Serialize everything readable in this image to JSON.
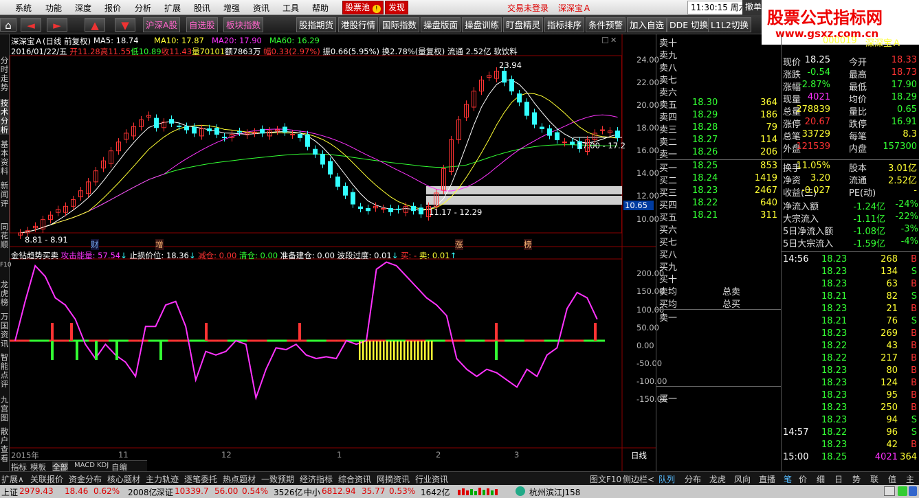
{
  "menu": {
    "items": [
      "系统",
      "功能",
      "深度",
      "报价",
      "分析",
      "扩展",
      "股讯",
      "增强",
      "资讯",
      "工具",
      "帮助"
    ],
    "stock_pool": "股票池",
    "discover": "发现",
    "login_status": "交易未登录",
    "stock_title": "深深宝Ａ",
    "clock": "11:30:15 周六",
    "cancel": "撤单",
    "watermark_title": "股票公式指标网",
    "watermark_url": "www.gsxz.com.cn"
  },
  "toolbar": {
    "home": "⌂",
    "back": "◄",
    "forward": "►",
    "up": "▲",
    "down": "▼",
    "buttons": [
      "沪深A股",
      "自选股",
      "板块指数",
      "股指期货",
      "港股行情",
      "国际指数",
      "操盘版面",
      "操盘训练",
      "盯盘精灵",
      "指标排序",
      "条件预警",
      "加入自选",
      "DDE 切换",
      "L1L2切换"
    ]
  },
  "leftnav": [
    "分时走势",
    "技术分析",
    "基本资料",
    "新闻评",
    "同花顺",
    "F10",
    "龙虎榜",
    "万国资讯",
    "智能点评",
    "九宫图",
    "散户查看"
  ],
  "chart": {
    "header": "深深宝Ａ(日线 前复权)",
    "ma": [
      {
        "label": "MA5: 18.74",
        "color": "#ffffff"
      },
      {
        "label": "MA10: 17.87",
        "color": "#ffff33"
      },
      {
        "label": "MA20: 17.90",
        "color": "#ff33ff"
      },
      {
        "label": "MA60: 16.29",
        "color": "#33ff33"
      }
    ],
    "info_date": "2016/01/22/五",
    "info_open": "开11.28",
    "info_high": "高11.55",
    "info_low": "低10.89",
    "info_close": "收11.43",
    "info_vol": "量70101",
    "info_amt": "额7863万",
    "info_chg": "幅0.33(2.97%)",
    "info_amp": "振0.66(5.95%)",
    "info_turn": "换2.78%(量复权)",
    "info_float": "流通 2.52亿 软饮料",
    "price_ticks": [
      "24.00",
      "22.00",
      "20.00",
      "18.00",
      "16.00",
      "14.00",
      "12.00",
      "10.00"
    ],
    "annotations": {
      "high": "23.94",
      "range1": "17.00 - 17.2",
      "range2": "11.17 - 12.29",
      "low": "8.81 - 8.91",
      "cur_price": "10.65"
    },
    "events": [
      "财",
      "增",
      "涨",
      "榜"
    ],
    "ind_title": "金钻趋势买卖",
    "ind_atk": "攻击能量: 57.54",
    "ind_stop": "止损价位: 18.36",
    "ind_reduce": "减仓: 0.00",
    "ind_clear": "清仓: 0.00",
    "ind_prep": "准备建仓: 0.00",
    "ind_swing": "波段过度: 0.01",
    "ind_buy": "买: -",
    "ind_sell": "卖: 0.01",
    "ind_ticks": [
      "200.00",
      "150.00",
      "100.00",
      "50.00",
      "0.00",
      "-50.00",
      "-100.00",
      "-150.00"
    ],
    "xaxis": [
      "2015年",
      "11",
      "12",
      "1",
      "2",
      "3"
    ],
    "period": "日线",
    "subtabs": [
      "指标",
      "模板",
      "全部",
      "MACD",
      "KDJ",
      "自编"
    ]
  },
  "chart_data": {
    "type": "candlestick",
    "title": "深深宝Ａ(日线 前复权)",
    "ylim": [
      9,
      25
    ],
    "close": [
      9.0,
      9.2,
      9.6,
      10.2,
      10.6,
      11.1,
      11.4,
      12.0,
      12.8,
      13.6,
      14.6,
      15.5,
      16.4,
      17.2,
      18.0,
      18.6,
      19.2,
      19.6,
      18.5,
      19.0,
      18.9,
      18.6,
      18.3,
      18.0,
      18.4,
      18.2,
      17.9,
      17.6,
      17.9,
      18.1,
      18.0,
      18.1,
      18.0,
      18.2,
      18.3,
      18.1,
      17.9,
      17.6,
      16.8,
      16.1,
      15.2,
      14.3,
      13.2,
      12.4,
      11.6,
      11.2,
      11.0,
      11.4,
      11.2,
      10.9,
      11.1,
      11.4,
      11.0,
      10.7,
      11.4,
      12.6,
      14.8,
      17.4,
      19.2,
      20.6,
      21.8,
      22.8,
      23.2,
      23.6,
      22.6,
      21.8,
      20.8,
      19.6,
      18.8,
      18.4,
      17.8,
      17.4,
      17.2,
      17.0,
      16.6,
      17.4,
      18.0,
      18.3,
      18.2,
      17.6
    ]
  },
  "orderbook": {
    "sell_labels": [
      "卖十",
      "卖九",
      "卖八",
      "卖七",
      "卖六",
      "卖五",
      "卖四",
      "卖三",
      "卖二",
      "卖一"
    ],
    "sell_prices": [
      "",
      "",
      "",
      "",
      "",
      "18.30",
      "18.29",
      "18.28",
      "18.27",
      "18.26"
    ],
    "sell_vols": [
      "",
      "",
      "",
      "",
      "",
      "364",
      "186",
      "79",
      "114",
      "206"
    ],
    "buy_labels": [
      "买一",
      "买二",
      "买三",
      "买四",
      "买五",
      "买六",
      "买七",
      "买八",
      "买九",
      "买十"
    ],
    "buy_prices": [
      "18.25",
      "18.24",
      "18.23",
      "18.22",
      "18.21",
      "",
      "",
      "",
      "",
      ""
    ],
    "buy_vols": [
      "853",
      "1419",
      "2467",
      "640",
      "311",
      "",
      "",
      "",
      "",
      ""
    ],
    "avg_sell": "卖均",
    "avg_buy": "买均",
    "total_sell": "总卖",
    "total_buy": "总买",
    "sell_one": "卖一",
    "buy_one": "买一"
  },
  "quote": {
    "code": "000019",
    "name": "深深宝Ａ",
    "type_label": "现价",
    "rows": [
      {
        "l": "现价",
        "v": "18.25",
        "c": "#ffffff",
        "l2": "今开",
        "v2": "18.33",
        "c2": "#ff3333"
      },
      {
        "l": "涨跌",
        "v": "-0.54",
        "c": "#33ff33",
        "l2": "最高",
        "v2": "18.73",
        "c2": "#ff3333"
      },
      {
        "l": "涨幅",
        "v": "-2.87%",
        "c": "#33ff33",
        "l2": "最低",
        "v2": "17.90",
        "c2": "#33ff33"
      },
      {
        "l": "现量",
        "v": "4021",
        "c": "#ff33ff",
        "l2": "均价",
        "v2": "18.29",
        "c2": "#33ff33"
      },
      {
        "l": "总量",
        "v": "278839",
        "c": "#ffff33",
        "l2": "量比",
        "v2": "0.65",
        "c2": "#33ff33"
      },
      {
        "l": "涨停",
        "v": "20.67",
        "c": "#ff3333",
        "l2": "跌停",
        "v2": "16.91",
        "c2": "#33ff33"
      },
      {
        "l": "总笔",
        "v": "33729",
        "c": "#ffff33",
        "l2": "每笔",
        "v2": "8.3",
        "c2": "#ffff33"
      },
      {
        "l": "外盘",
        "v": "121539",
        "c": "#ff3333",
        "l2": "内盘",
        "v2": "157300",
        "c2": "#33ff33"
      },
      {
        "l": "换手",
        "v": "11.05%",
        "c": "#ffff33",
        "l2": "股本",
        "v2": "3.01亿",
        "c2": "#ffff33"
      },
      {
        "l": "净资",
        "v": "3.20",
        "c": "#ffff33",
        "l2": "流通",
        "v2": "2.52亿",
        "c2": "#ffff33"
      },
      {
        "l": "收益(三)",
        "v": "-0.027",
        "c": "#ffff33",
        "l2": "PE(动)",
        "v2": "-",
        "c2": "#ffff33"
      }
    ],
    "flows": [
      {
        "l": "净流入额",
        "v": "-1.24亿",
        "p": "-24%"
      },
      {
        "l": "大宗流入",
        "v": "-1.11亿",
        "p": "-22%"
      },
      {
        "l": "5日净流入额",
        "v": "-1.08亿",
        "p": "-3%"
      },
      {
        "l": "5日大宗流入",
        "v": "-1.59亿",
        "p": "-4%"
      }
    ],
    "ticks": [
      {
        "t": "14:56",
        "p": "18.23",
        "v": "268",
        "d": "B"
      },
      {
        "t": "",
        "p": "18.23",
        "v": "134",
        "d": "S"
      },
      {
        "t": "",
        "p": "18.23",
        "v": "63",
        "d": "B"
      },
      {
        "t": "",
        "p": "18.21",
        "v": "82",
        "d": "S"
      },
      {
        "t": "",
        "p": "18.23",
        "v": "21",
        "d": "B"
      },
      {
        "t": "",
        "p": "18.21",
        "v": "76",
        "d": "S"
      },
      {
        "t": "",
        "p": "18.23",
        "v": "269",
        "d": "B"
      },
      {
        "t": "",
        "p": "18.22",
        "v": "43",
        "d": "B"
      },
      {
        "t": "",
        "p": "18.22",
        "v": "217",
        "d": "B"
      },
      {
        "t": "",
        "p": "18.23",
        "v": "80",
        "d": "B"
      },
      {
        "t": "",
        "p": "18.23",
        "v": "124",
        "d": "B"
      },
      {
        "t": "",
        "p": "18.23",
        "v": "95",
        "d": "B"
      },
      {
        "t": "",
        "p": "18.23",
        "v": "250",
        "d": "B"
      },
      {
        "t": "",
        "p": "18.23",
        "v": "94",
        "d": "S"
      },
      {
        "t": "14:57",
        "p": "18.22",
        "v": "96",
        "d": "S"
      },
      {
        "t": "",
        "p": "18.23",
        "v": "42",
        "d": "B"
      },
      {
        "t": "15:00",
        "p": "18.25",
        "v": "4021",
        "d": "364"
      }
    ]
  },
  "bottomtabs": {
    "left": [
      "扩展∧",
      "关联报价",
      "资金分布",
      "核心题材",
      "主力轨迹",
      "逐笔委托",
      "热点题材",
      "一致预期",
      "经济指标",
      "综合资讯",
      "网摘资讯",
      "行业资讯"
    ],
    "mid": [
      "图文F10",
      "侧边栏<"
    ],
    "right": [
      "队列",
      "分布",
      "龙虎",
      "风向",
      "直播",
      "笔",
      "价",
      "细",
      "日",
      "势",
      "联",
      "值",
      "主"
    ]
  },
  "status": {
    "sh_label": "上证",
    "sh_val": "2979.43",
    "sh_chg": "18.46",
    "sh_pct": "0.62%",
    "sh_amt": "2008亿",
    "sz_label": "深证",
    "sz_val": "10339.7",
    "sz_chg": "56.00",
    "sz_pct": "0.54%",
    "sz_amt": "3526亿",
    "zx_label": "中小",
    "zx_val": "6812.94",
    "zx_chg": "35.77",
    "zx_pct": "0.53%",
    "zx_amt": "1642亿",
    "site": "杭州滨江J158"
  }
}
